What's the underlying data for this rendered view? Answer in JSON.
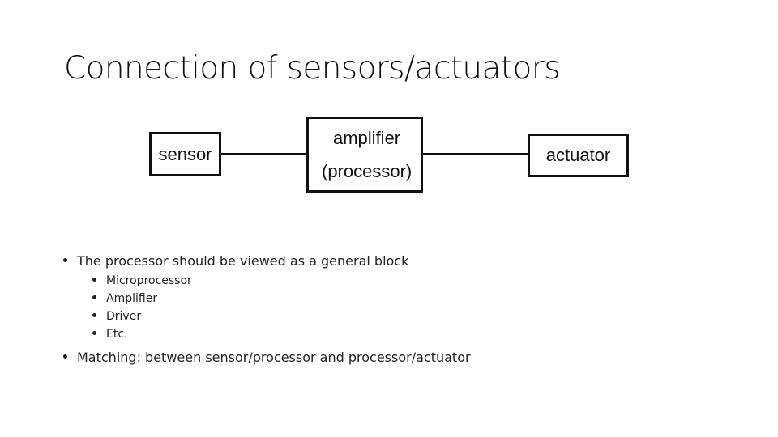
{
  "slide": {
    "title": "Connection of sensors/actuators",
    "diagram": {
      "blocks": [
        {
          "id": "sensor",
          "label": "sensor"
        },
        {
          "id": "amplifier",
          "line1": "amplifier",
          "line2": "(processor)"
        },
        {
          "id": "actuator",
          "label": "actuator"
        }
      ]
    },
    "bullets": [
      {
        "text": "The processor should be viewed as a general block",
        "sub": [
          "Microprocessor",
          "Amplifier",
          "Driver",
          "Etc."
        ]
      },
      {
        "text": "Matching: between sensor/processor and processor/actuator",
        "sub": []
      }
    ]
  }
}
